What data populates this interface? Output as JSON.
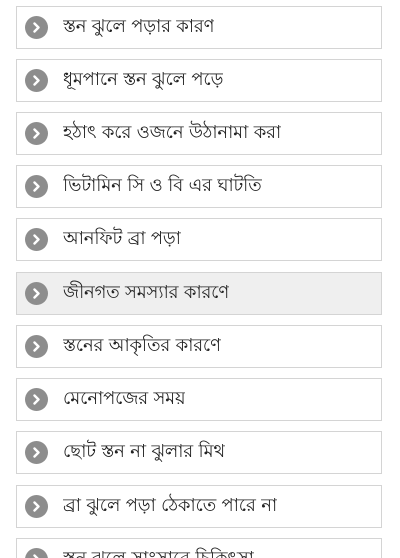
{
  "list": {
    "items": [
      {
        "label": "স্তন ঝুলে পড়ার কারণ",
        "icon": "chevron-right-icon",
        "highlighted": false
      },
      {
        "label": "ধূমপানে স্তন ঝুলে পড়ে",
        "icon": "chevron-right-icon",
        "highlighted": false
      },
      {
        "label": "হঠাৎ করে ওজনে উঠানামা করা",
        "icon": "chevron-right-icon",
        "highlighted": false
      },
      {
        "label": "ভিটামিন সি ও বি এর ঘাটতি",
        "icon": "chevron-right-icon",
        "highlighted": false
      },
      {
        "label": "আনফিট ব্রা পড়া",
        "icon": "chevron-right-icon",
        "highlighted": false
      },
      {
        "label": "জীনগত সমস্যার কারণে",
        "icon": "chevron-right-icon",
        "highlighted": true
      },
      {
        "label": "স্তনের আকৃতির কারণে",
        "icon": "chevron-right-icon",
        "highlighted": false
      },
      {
        "label": "মেনোপজের সময়",
        "icon": "chevron-right-icon",
        "highlighted": false
      },
      {
        "label": "ছোট স্তন না ঝুলার মিথ",
        "icon": "chevron-right-icon",
        "highlighted": false
      },
      {
        "label": "ব্রা ঝুলে পড়া ঠেকাতে পারে না",
        "icon": "chevron-right-icon",
        "highlighted": false
      },
      {
        "label": "স্তন ঝুলে সাংসারে চিকিৎসা",
        "icon": "chevron-right-icon",
        "highlighted": false
      }
    ]
  },
  "colors": {
    "border": "#d4d4d4",
    "icon": "#8d8d8d",
    "highlight": "#efefef",
    "text": "#222222"
  }
}
